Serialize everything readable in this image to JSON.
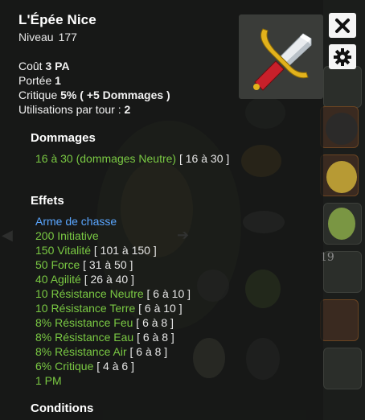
{
  "tooltip": {
    "title": "L'Épée Nice",
    "level_label": "Niveau",
    "level_value": "177",
    "cost_label": "Coût",
    "cost_value": "3 PA",
    "range_label": "Portée",
    "range_value": "1",
    "critical_label": "Critique",
    "critical_value": "5% ( +5 Dommages )",
    "uses_label": "Utilisations par tour :",
    "uses_value": "2",
    "damage_title": "Dommages",
    "damage_text": "16 à 30 (dommages Neutre)",
    "damage_range": "[ 16 à 30 ]",
    "effects_title": "Effets",
    "effect_header": "Arme de chasse",
    "effects": [
      {
        "value": "200 Initiative",
        "range": ""
      },
      {
        "value": "150 Vitalité",
        "range": "[ 101 à 150 ]"
      },
      {
        "value": "50 Force",
        "range": "[ 31 à 50 ]"
      },
      {
        "value": "40 Agilité",
        "range": "[ 26 à 40 ]"
      },
      {
        "value": "10 Résistance Neutre",
        "range": "[ 6 à 10 ]"
      },
      {
        "value": "10 Résistance Terre",
        "range": "[ 6 à 10 ]"
      },
      {
        "value": "8% Résistance Feu",
        "range": "[ 6 à 8 ]"
      },
      {
        "value": "8% Résistance Eau",
        "range": "[ 6 à 8 ]"
      },
      {
        "value": "8% Résistance Air",
        "range": "[ 6 à 8 ]"
      },
      {
        "value": "6% Critique",
        "range": "[ 4 à 6 ]"
      },
      {
        "value": "1 PM",
        "range": ""
      }
    ],
    "conditions_title": "Conditions"
  },
  "background": {
    "inventory_count": "19"
  },
  "icons": {
    "item": "sword-icon",
    "close": "close-icon",
    "settings": "gear-icon"
  },
  "colors": {
    "effect_green": "#7ac943",
    "header_blue": "#5aa6ff",
    "tooltip_bg": "#1b1d1b"
  }
}
